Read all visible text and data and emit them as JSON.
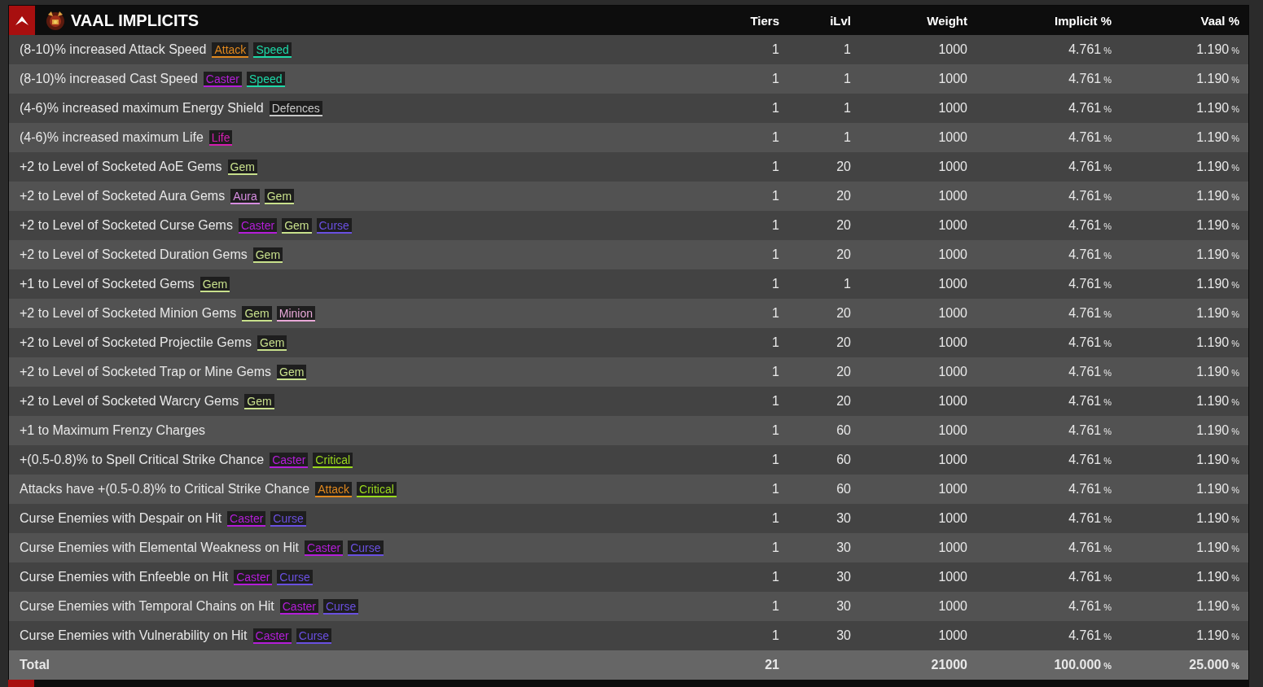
{
  "section": {
    "title": "VAAL IMPLICITS",
    "columns": [
      "Tiers",
      "iLvl",
      "Weight",
      "Implicit %",
      "Vaal %"
    ]
  },
  "rows": [
    {
      "name": "(8-10)% increased Attack Speed",
      "tags": [
        {
          "label": "Attack",
          "color": "#e0881e"
        },
        {
          "label": "Speed",
          "color": "#1ed9a8"
        }
      ],
      "tiers": "1",
      "ilvl": "1",
      "weight": "1000",
      "implicit": {
        "value": "4.761",
        "unit": "%"
      },
      "vaal": {
        "value": "1.190",
        "unit": "%"
      }
    },
    {
      "name": "(8-10)% increased Cast Speed",
      "tags": [
        {
          "label": "Caster",
          "color": "#b41ed9"
        },
        {
          "label": "Speed",
          "color": "#1ed9a8"
        }
      ],
      "tiers": "1",
      "ilvl": "1",
      "weight": "1000",
      "implicit": {
        "value": "4.761",
        "unit": "%"
      },
      "vaal": {
        "value": "1.190",
        "unit": "%"
      }
    },
    {
      "name": "(4-6)% increased maximum Energy Shield",
      "tags": [
        {
          "label": "Defences",
          "color": "#c8c8c8"
        }
      ],
      "tiers": "1",
      "ilvl": "1",
      "weight": "1000",
      "implicit": {
        "value": "4.761",
        "unit": "%"
      },
      "vaal": {
        "value": "1.190",
        "unit": "%"
      }
    },
    {
      "name": "(4-6)% increased maximum Life",
      "tags": [
        {
          "label": "Life",
          "color": "#d41eb0"
        }
      ],
      "tiers": "1",
      "ilvl": "1",
      "weight": "1000",
      "implicit": {
        "value": "4.761",
        "unit": "%"
      },
      "vaal": {
        "value": "1.190",
        "unit": "%"
      }
    },
    {
      "name": "+2 to Level of Socketed AoE Gems",
      "tags": [
        {
          "label": "Gem",
          "color": "#c8e08c"
        }
      ],
      "tiers": "1",
      "ilvl": "20",
      "weight": "1000",
      "implicit": {
        "value": "4.761",
        "unit": "%"
      },
      "vaal": {
        "value": "1.190",
        "unit": "%"
      }
    },
    {
      "name": "+2 to Level of Socketed Aura Gems",
      "tags": [
        {
          "label": "Aura",
          "color": "#d68ce0"
        },
        {
          "label": "Gem",
          "color": "#c8e08c"
        }
      ],
      "tiers": "1",
      "ilvl": "20",
      "weight": "1000",
      "implicit": {
        "value": "4.761",
        "unit": "%"
      },
      "vaal": {
        "value": "1.190",
        "unit": "%"
      }
    },
    {
      "name": "+2 to Level of Socketed Curse Gems",
      "tags": [
        {
          "label": "Caster",
          "color": "#b41ed9"
        },
        {
          "label": "Gem",
          "color": "#c8e08c"
        },
        {
          "label": "Curse",
          "color": "#6a50e0"
        }
      ],
      "tiers": "1",
      "ilvl": "20",
      "weight": "1000",
      "implicit": {
        "value": "4.761",
        "unit": "%"
      },
      "vaal": {
        "value": "1.190",
        "unit": "%"
      }
    },
    {
      "name": "+2 to Level of Socketed Duration Gems",
      "tags": [
        {
          "label": "Gem",
          "color": "#c8e08c"
        }
      ],
      "tiers": "1",
      "ilvl": "20",
      "weight": "1000",
      "implicit": {
        "value": "4.761",
        "unit": "%"
      },
      "vaal": {
        "value": "1.190",
        "unit": "%"
      }
    },
    {
      "name": "+1 to Level of Socketed Gems",
      "tags": [
        {
          "label": "Gem",
          "color": "#c8e08c"
        }
      ],
      "tiers": "1",
      "ilvl": "1",
      "weight": "1000",
      "implicit": {
        "value": "4.761",
        "unit": "%"
      },
      "vaal": {
        "value": "1.190",
        "unit": "%"
      }
    },
    {
      "name": "+2 to Level of Socketed Minion Gems",
      "tags": [
        {
          "label": "Gem",
          "color": "#c8e08c"
        },
        {
          "label": "Minion",
          "color": "#e8a8d8"
        }
      ],
      "tiers": "1",
      "ilvl": "20",
      "weight": "1000",
      "implicit": {
        "value": "4.761",
        "unit": "%"
      },
      "vaal": {
        "value": "1.190",
        "unit": "%"
      }
    },
    {
      "name": "+2 to Level of Socketed Projectile Gems",
      "tags": [
        {
          "label": "Gem",
          "color": "#c8e08c"
        }
      ],
      "tiers": "1",
      "ilvl": "20",
      "weight": "1000",
      "implicit": {
        "value": "4.761",
        "unit": "%"
      },
      "vaal": {
        "value": "1.190",
        "unit": "%"
      }
    },
    {
      "name": "+2 to Level of Socketed Trap or Mine Gems",
      "tags": [
        {
          "label": "Gem",
          "color": "#c8e08c"
        }
      ],
      "tiers": "1",
      "ilvl": "20",
      "weight": "1000",
      "implicit": {
        "value": "4.761",
        "unit": "%"
      },
      "vaal": {
        "value": "1.190",
        "unit": "%"
      }
    },
    {
      "name": "+2 to Level of Socketed Warcry Gems",
      "tags": [
        {
          "label": "Gem",
          "color": "#c8e08c"
        }
      ],
      "tiers": "1",
      "ilvl": "20",
      "weight": "1000",
      "implicit": {
        "value": "4.761",
        "unit": "%"
      },
      "vaal": {
        "value": "1.190",
        "unit": "%"
      }
    },
    {
      "name": "+1 to Maximum Frenzy Charges",
      "tags": [],
      "tiers": "1",
      "ilvl": "60",
      "weight": "1000",
      "implicit": {
        "value": "4.761",
        "unit": "%"
      },
      "vaal": {
        "value": "1.190",
        "unit": "%"
      }
    },
    {
      "name": "+(0.5-0.8)% to Spell Critical Strike Chance",
      "tags": [
        {
          "label": "Caster",
          "color": "#b41ed9"
        },
        {
          "label": "Critical",
          "color": "#9ad91e"
        }
      ],
      "tiers": "1",
      "ilvl": "60",
      "weight": "1000",
      "implicit": {
        "value": "4.761",
        "unit": "%"
      },
      "vaal": {
        "value": "1.190",
        "unit": "%"
      }
    },
    {
      "name": "Attacks have +(0.5-0.8)% to Critical Strike Chance",
      "tags": [
        {
          "label": "Attack",
          "color": "#e0881e"
        },
        {
          "label": "Critical",
          "color": "#9ad91e"
        }
      ],
      "tiers": "1",
      "ilvl": "60",
      "weight": "1000",
      "implicit": {
        "value": "4.761",
        "unit": "%"
      },
      "vaal": {
        "value": "1.190",
        "unit": "%"
      }
    },
    {
      "name": "Curse Enemies with Despair on Hit",
      "tags": [
        {
          "label": "Caster",
          "color": "#b41ed9"
        },
        {
          "label": "Curse",
          "color": "#6a50e0"
        }
      ],
      "tiers": "1",
      "ilvl": "30",
      "weight": "1000",
      "implicit": {
        "value": "4.761",
        "unit": "%"
      },
      "vaal": {
        "value": "1.190",
        "unit": "%"
      }
    },
    {
      "name": "Curse Enemies with Elemental Weakness on Hit",
      "tags": [
        {
          "label": "Caster",
          "color": "#b41ed9"
        },
        {
          "label": "Curse",
          "color": "#6a50e0"
        }
      ],
      "tiers": "1",
      "ilvl": "30",
      "weight": "1000",
      "implicit": {
        "value": "4.761",
        "unit": "%"
      },
      "vaal": {
        "value": "1.190",
        "unit": "%"
      }
    },
    {
      "name": "Curse Enemies with Enfeeble on Hit",
      "tags": [
        {
          "label": "Caster",
          "color": "#b41ed9"
        },
        {
          "label": "Curse",
          "color": "#6a50e0"
        }
      ],
      "tiers": "1",
      "ilvl": "30",
      "weight": "1000",
      "implicit": {
        "value": "4.761",
        "unit": "%"
      },
      "vaal": {
        "value": "1.190",
        "unit": "%"
      }
    },
    {
      "name": "Curse Enemies with Temporal Chains on Hit",
      "tags": [
        {
          "label": "Caster",
          "color": "#b41ed9"
        },
        {
          "label": "Curse",
          "color": "#6a50e0"
        }
      ],
      "tiers": "1",
      "ilvl": "30",
      "weight": "1000",
      "implicit": {
        "value": "4.761",
        "unit": "%"
      },
      "vaal": {
        "value": "1.190",
        "unit": "%"
      }
    },
    {
      "name": "Curse Enemies with Vulnerability on Hit",
      "tags": [
        {
          "label": "Caster",
          "color": "#b41ed9"
        },
        {
          "label": "Curse",
          "color": "#6a50e0"
        }
      ],
      "tiers": "1",
      "ilvl": "30",
      "weight": "1000",
      "implicit": {
        "value": "4.761",
        "unit": "%"
      },
      "vaal": {
        "value": "1.190",
        "unit": "%"
      }
    }
  ],
  "total": {
    "label": "Total",
    "tiers": "21",
    "weight": "21000",
    "implicit": {
      "value": "100.000",
      "unit": "%"
    },
    "vaal": {
      "value": "25.000",
      "unit": "%"
    }
  }
}
